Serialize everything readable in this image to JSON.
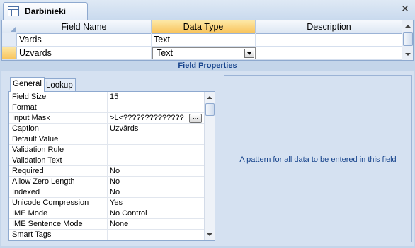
{
  "document_tab": {
    "title": "Darbinieki"
  },
  "grid": {
    "columns": [
      "Field Name",
      "Data Type",
      "Description"
    ],
    "rows": [
      {
        "field_name": "Vards",
        "data_type": "Text",
        "description": ""
      },
      {
        "field_name": "Uzvards",
        "data_type": "Text",
        "description": ""
      }
    ]
  },
  "field_properties": {
    "title": "Field Properties",
    "tabs": [
      "General",
      "Lookup"
    ],
    "active_tab": "General",
    "properties": [
      {
        "label": "Field Size",
        "value": "15"
      },
      {
        "label": "Format",
        "value": ""
      },
      {
        "label": "Input Mask",
        "value": ">L<??????????????"
      },
      {
        "label": "Caption",
        "value": "Uzvārds"
      },
      {
        "label": "Default Value",
        "value": ""
      },
      {
        "label": "Validation Rule",
        "value": ""
      },
      {
        "label": "Validation Text",
        "value": ""
      },
      {
        "label": "Required",
        "value": "No"
      },
      {
        "label": "Allow Zero Length",
        "value": "No"
      },
      {
        "label": "Indexed",
        "value": "No"
      },
      {
        "label": "Unicode Compression",
        "value": "Yes"
      },
      {
        "label": "IME Mode",
        "value": "No Control"
      },
      {
        "label": "IME Sentence Mode",
        "value": "None"
      },
      {
        "label": "Smart Tags",
        "value": ""
      }
    ],
    "help_text": "A pattern for all data to be entered in this field"
  },
  "icons": {
    "table": "table-icon",
    "close": "close-icon",
    "dropdown": "chevron-down-icon",
    "build": "build-ellipsis-icon"
  },
  "colors": {
    "accent": "#f8c35a",
    "panel": "#d5e1f1",
    "heading_text": "#15428b"
  }
}
